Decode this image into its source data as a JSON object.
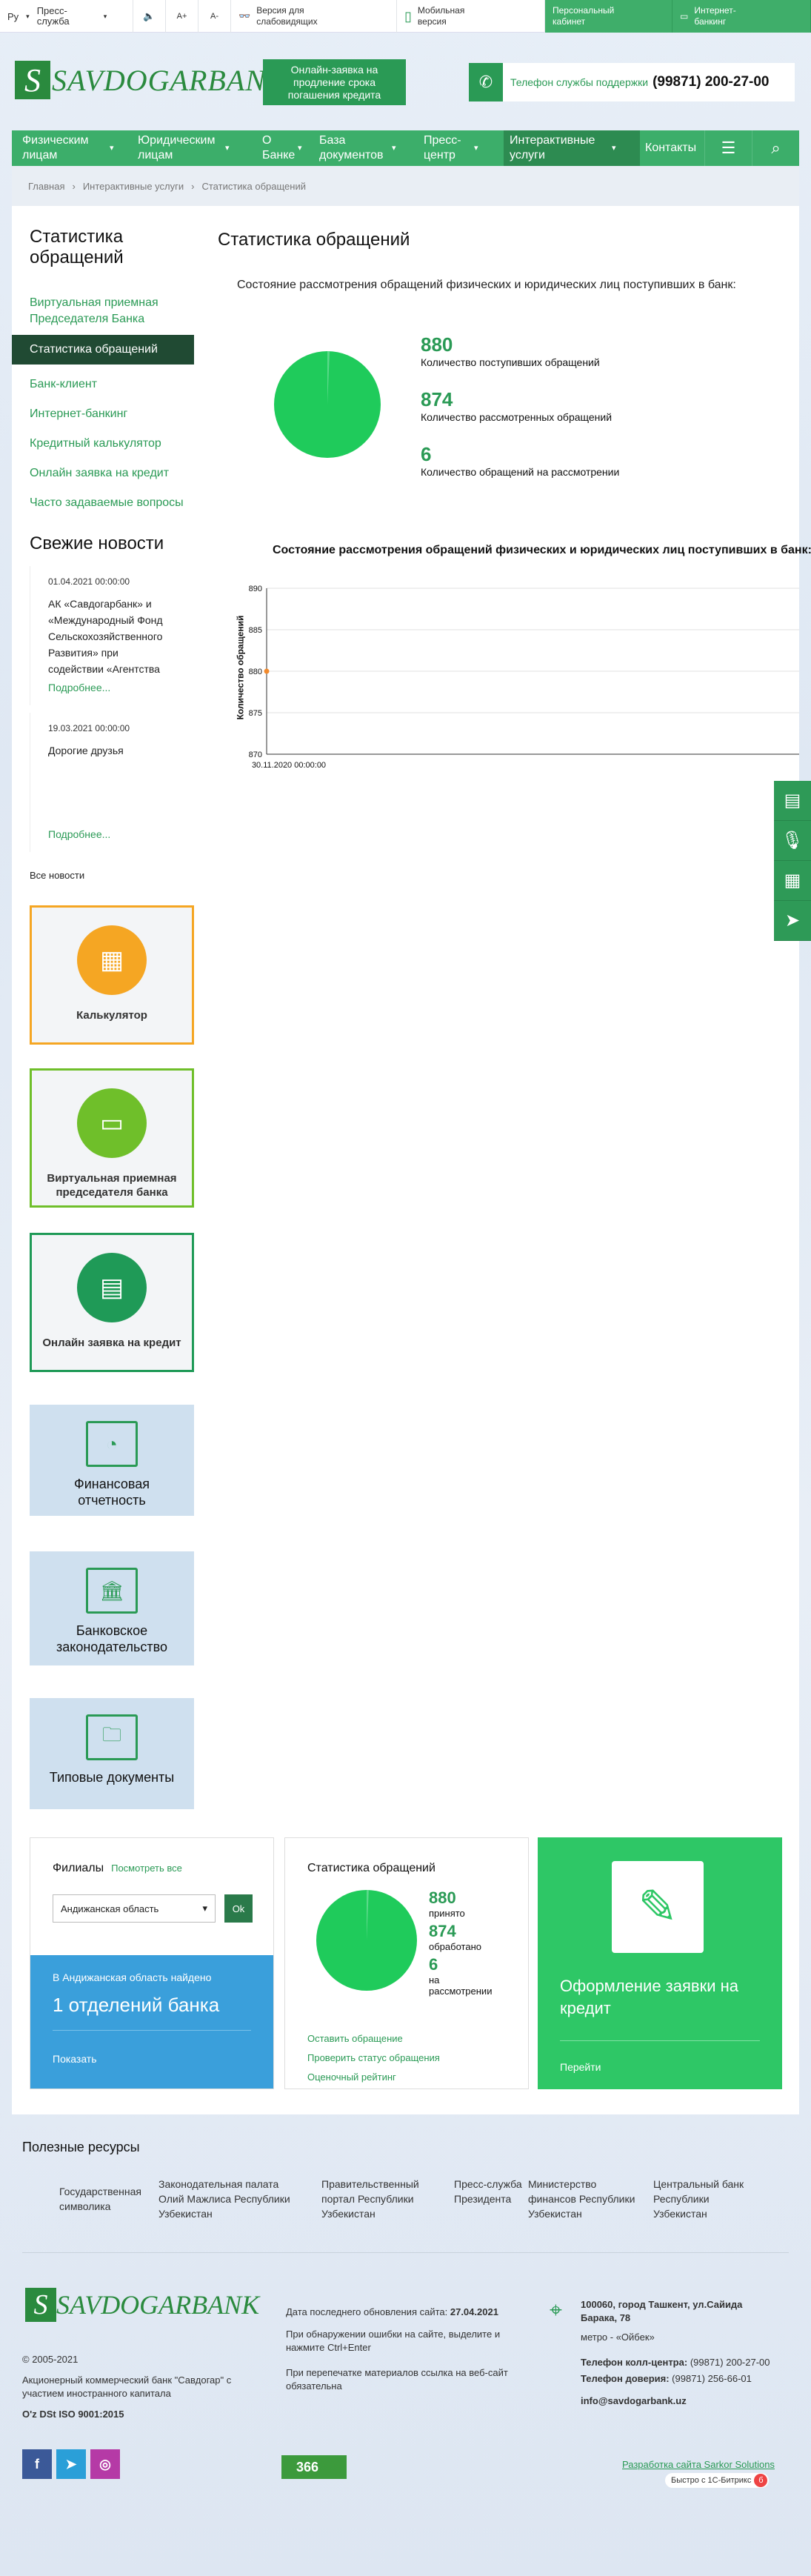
{
  "topbar": {
    "lang": "Ру",
    "press": "Пресс-служба",
    "font_plus": "A+",
    "font_minus": "A-",
    "impaired": "Версия для слабовидящих",
    "mobile": "Мобильная версия",
    "cabinet": "Персональный кабинет",
    "ibank": "Интернет-банкинг"
  },
  "header": {
    "logo": "SAVDOGARBANK",
    "online_btn": "Онлайн-заявка на продление срока погашения кредита",
    "support_label": "Телефон службы поддержки",
    "support_phone": "(99871) 200-27-00"
  },
  "nav": [
    {
      "label": "Физическим лицам"
    },
    {
      "label": "Юридическим лицам"
    },
    {
      "label": "О Банке"
    },
    {
      "label": "База документов"
    },
    {
      "label": "Пресс-центр"
    },
    {
      "label": "Интерактивные услуги"
    },
    {
      "label": "Контакты"
    }
  ],
  "breadcrumb": [
    "Главная",
    "Интерактивные услуги",
    "Статистика обращений"
  ],
  "sidebar": {
    "title": "Статистика обращений",
    "items": [
      "Виртуальная приемная Председателя Банка",
      "Статистика обращений",
      "Банк-клиент",
      "Интернет-банкинг",
      "Кредитный калькулятор",
      "Онлайн заявка на кредит",
      "Часто задаваемые вопросы"
    ]
  },
  "news": {
    "title": "Свежие новости",
    "items": [
      {
        "date": "01.04.2021 00:00:00",
        "text": "АК «Савдогарбанк» и «Международный Фонд Сельскохозяйственного Развития» при содействии «Агентства",
        "more": "Подробнее..."
      },
      {
        "date": "19.03.2021 00:00:00",
        "text": "Дорогие друзья",
        "more": "Подробнее..."
      }
    ],
    "all": "Все новости"
  },
  "widgets": [
    "Калькулятор",
    "Виртуальная приемная председателя банка",
    "Онлайн заявка на кредит"
  ],
  "docs": [
    "Финансовая отчетность",
    "Банковское законодательство",
    "Типовые документы"
  ],
  "content": {
    "title": "Статистика обращений",
    "subtitle": "Состояние рассмотрения обращений физических и юридических лиц поступивших в банк:",
    "stats": [
      {
        "value": "880",
        "label": "Количество поступивших обращений"
      },
      {
        "value": "874",
        "label": "Количество рассмотренных обращений"
      },
      {
        "value": "6",
        "label": "Количество обращений на рассмотрении"
      }
    ]
  },
  "chart_data": {
    "type": "line",
    "title": "Состояние рассмотрения обращений физических и юридических лиц поступивших в банк:",
    "ylabel": "Количество обращений",
    "ylim": [
      870,
      890
    ],
    "yticks": [
      870,
      875,
      880,
      885,
      890
    ],
    "x": [
      "30.11.2020 00:00:00"
    ],
    "series": [
      {
        "name": "",
        "color": "#f28a2c",
        "values": [
          880
        ]
      }
    ],
    "grid": true
  },
  "pie": {
    "received": 880,
    "reviewed": 874,
    "pending": 6
  },
  "branches": {
    "title": "Филиалы",
    "show_all": "Посмотреть все",
    "select": "Андижанская область",
    "ok": "Ok",
    "found": "В Андижанская область найдено",
    "count": "1 отделений банка",
    "show": "Показать"
  },
  "stat_card": {
    "title": "Статистика обращений",
    "items": [
      {
        "value": "880",
        "label": "принято"
      },
      {
        "value": "874",
        "label": "обработано"
      },
      {
        "value": "6",
        "label": "на рассмотрении"
      }
    ],
    "links": [
      "Оставить обращение",
      "Проверить статус обращения",
      "Оценочный рейтинг"
    ]
  },
  "credit_card": {
    "title": "Оформление заявки на кредит",
    "go": "Перейти"
  },
  "useful": {
    "title": "Полезные ресурсы",
    "items": [
      "Государственная символика",
      "Законодательная палата Олий Мажлиса Республики Узбекистан",
      "Правительственный портал Республики Узбекистан",
      "Пресс-служба Президента",
      "Министерство финансов Республики Узбекистан",
      "Центральный банк Республики Узбекистан"
    ]
  },
  "footer": {
    "copyright": "© 2005-2021",
    "company": "Акционерный коммерческий банк \"Савдогар\" с участием иностранного капитала",
    "iso": "O'z DSt ISO 9001:2015",
    "updated_label": "Дата последнего обновления сайта:",
    "updated": "27.04.2021",
    "error_note": "При обнаружении ошибки на сайте, выделите и нажмите Ctrl+Enter",
    "reprint": "При перепечатке материалов ссылка на веб-сайт обязательна",
    "address": "100060, город Ташкент, ул.Сайида Барака, 78",
    "metro": "метро - «Ойбек»",
    "call_label": "Телефон колл-центра:",
    "call": "(99871) 200-27-00",
    "trust_label": "Телефон доверия:",
    "trust": "(99871) 256-66-01",
    "email": "info@savdogarbank.uz",
    "dev": "Разработка сайта Sarkor Solutions",
    "bitrix": "Быстро с 1С-Битрикс",
    "counter": "366"
  }
}
